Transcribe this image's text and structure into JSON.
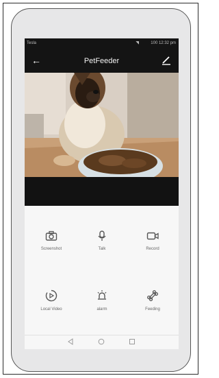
{
  "status_bar": {
    "carrier": "Tesla",
    "right_text": "100 12:32 pm"
  },
  "header": {
    "title": "PetFeeder",
    "back_icon": "arrow-left-icon",
    "edit_icon": "pencil-icon"
  },
  "video": {
    "description_icon": "live-camera-feed"
  },
  "controls": [
    {
      "label": "Screenshot",
      "icon": "camera-icon"
    },
    {
      "label": "Talk",
      "icon": "microphone-icon"
    },
    {
      "label": "Record",
      "icon": "video-record-icon"
    },
    {
      "label": "Local Video",
      "icon": "play-circle-icon"
    },
    {
      "label": "alarm",
      "icon": "alarm-light-icon"
    },
    {
      "label": "Feeding",
      "icon": "bone-icon"
    }
  ],
  "nav": [
    "back-triangle-icon",
    "home-circle-icon",
    "recents-square-icon"
  ],
  "colors": {
    "header_bg": "#141414",
    "controls_bg": "#f7f7f7",
    "icon_color": "#555555"
  }
}
